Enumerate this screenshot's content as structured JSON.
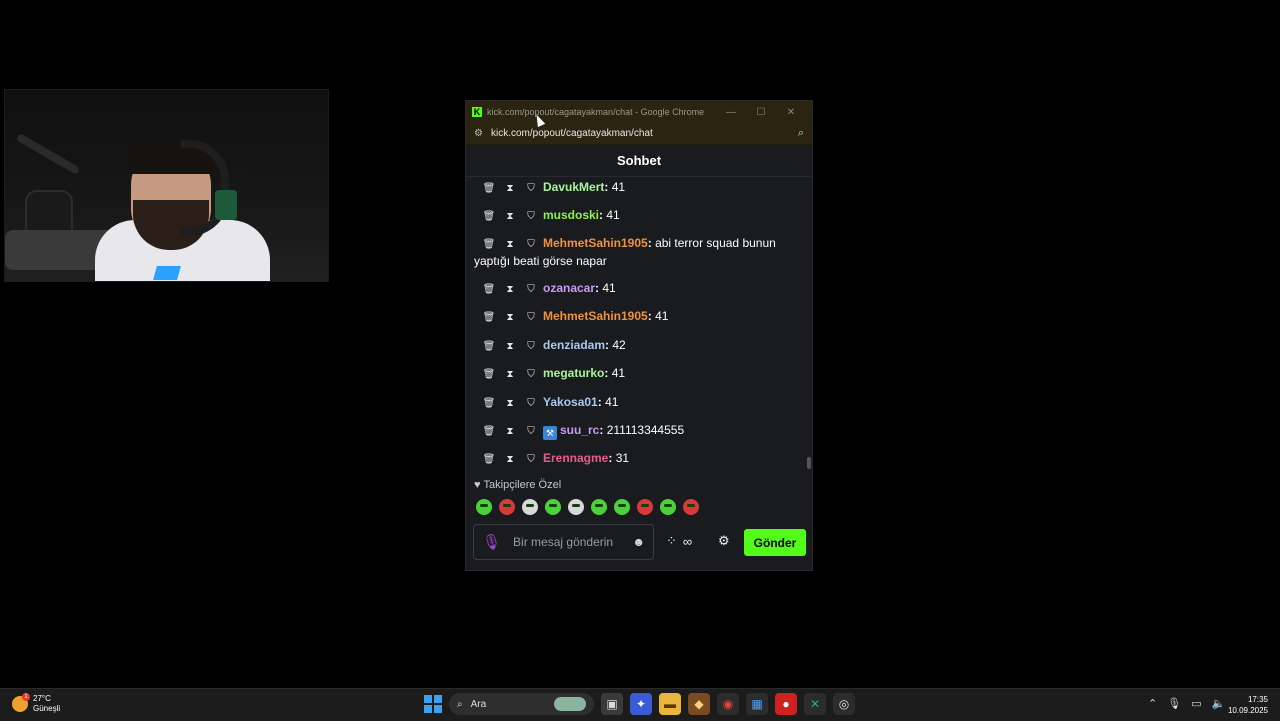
{
  "window": {
    "title": "kick.com/popout/cagatayakman/chat - Google Chrome",
    "logo_letter": "K",
    "url": "kick.com/popout/cagatayakman/chat",
    "controls": {
      "minimize": "—",
      "maximize": "☐",
      "close": "✕"
    }
  },
  "chat": {
    "header": "Sohbet",
    "messages": [
      {
        "user": "DavukMert",
        "text": "41",
        "color": "#a8f59a"
      },
      {
        "user": "musdoski",
        "text": "41",
        "color": "#8ef04e"
      },
      {
        "user": "MehmetSahin1905",
        "text": "abi terror squad bunun",
        "continuation": "yaptığı beati görse napar",
        "color": "#f0923e"
      },
      {
        "user": "ozanacar",
        "text": "41",
        "color": "#c79bf2"
      },
      {
        "user": "MehmetSahin1905",
        "text": "41",
        "color": "#f0923e"
      },
      {
        "user": "denziadam",
        "text": "42",
        "color": "#a9c8ee"
      },
      {
        "user": "megaturko",
        "text": "41",
        "color": "#a8f59a"
      },
      {
        "user": "Yakosa01",
        "text": "41",
        "color": "#a9c8ee"
      },
      {
        "user": "suu_rc",
        "text": "211113344555",
        "color": "#c79bf2",
        "has_badge": true
      },
      {
        "user": "Erennagme",
        "text": "31",
        "color": "#ee5a8a"
      }
    ],
    "separator": ":",
    "mod_icons": {
      "delete": "🗑",
      "timeout": "⧗",
      "ban": "⛉"
    },
    "followers_label": "Takipçilere Özel",
    "emote_count": 10,
    "composer_placeholder": "Bir mesaj gönderin",
    "send_label": "Gönder",
    "accent": "#53fc18"
  },
  "taskbar": {
    "weather_temp": "27°C",
    "weather_desc": "Güneşli",
    "weather_badge": "1",
    "search_label": "Ara",
    "time": "17:35",
    "date": "10.09.2025"
  }
}
